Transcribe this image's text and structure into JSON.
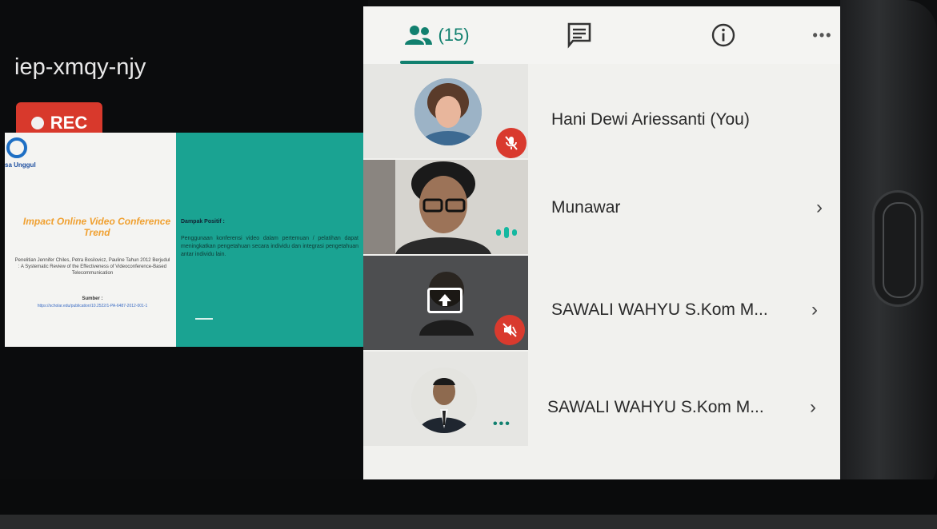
{
  "meeting": {
    "code": "iep-xmqy-njy",
    "rec_label": "REC"
  },
  "slide": {
    "logo_text": "sa Unggul",
    "title": "Impact Online Video Conference Trend",
    "body": "Penelitian Jennifer Chiles, Petra Bosilovicz, Pauline Tahun 2012 Berjudul : A Systematic Review of the Effectiveness of Videoconference-Based Telecommunication",
    "source_label": "Sumber :",
    "source_link": "https://scholar.edu/publication/10.2522/1-PA-6487-2012-001-1",
    "heading": "Dampak Positif :",
    "text": "Penggunaan konferensi video dalam pertemuan / pelatihan dapat meningkatkan pengetahuan secara individu dan integrasi pengetahuan antar individu lain."
  },
  "panel": {
    "tabs": {
      "people_count": "(15)"
    },
    "participants": [
      {
        "name": "Hani Dewi Ariessanti (You)",
        "status": "muted"
      },
      {
        "name": "Munawar",
        "status": "speaking"
      },
      {
        "name": "SAWALI WAHYU S.Kom M...",
        "status": "muted"
      },
      {
        "name": "SAWALI WAHYU S.Kom M...",
        "status": "more"
      }
    ],
    "chevron": "›"
  },
  "colors": {
    "accent": "#11806f",
    "rec": "#d8392c",
    "mute": "#d93a2e",
    "slide_green": "#1aa392"
  }
}
